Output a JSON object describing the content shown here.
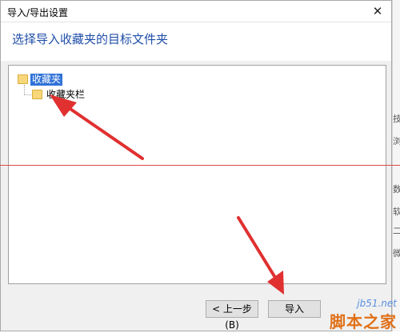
{
  "window": {
    "title": "导入/导出设置",
    "close_glyph": "✕"
  },
  "header": {
    "instruction": "选择导入收藏夹的目标文件夹"
  },
  "tree": {
    "root_label": "收藏夹",
    "child_label": "收藏夹栏"
  },
  "buttons": {
    "back_label": "< 上一步(B)",
    "import_label": "导入"
  },
  "side_strip": {
    "chars": [
      "技",
      "浏",
      "数",
      "软",
      "二",
      "微"
    ]
  },
  "watermark": {
    "url": "jb51.net",
    "name": "脚本之家"
  },
  "colors": {
    "header_text": "#1f4ea8",
    "selection": "#3072d8",
    "arrow": "#e03030",
    "watermark_orange": "#e07018"
  }
}
